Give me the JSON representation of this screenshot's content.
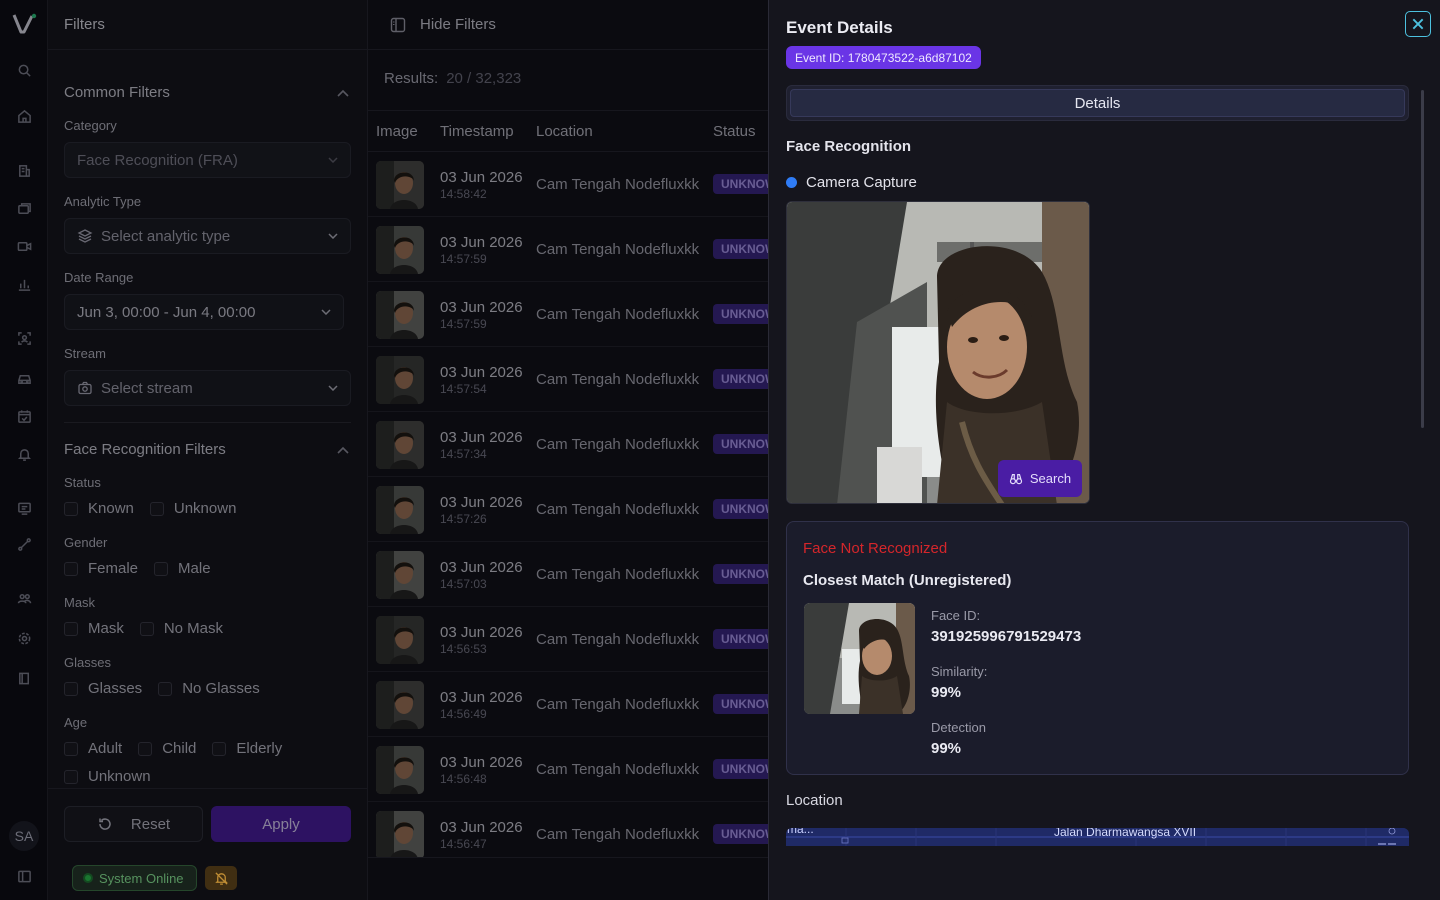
{
  "rail": {
    "avatar_initials": "SA",
    "icons": [
      "search-icon",
      "home-icon",
      "building-icon",
      "layers-icon",
      "camera-icon",
      "chart-icon",
      "face-scan-icon",
      "car-icon",
      "calendar-check-icon",
      "bell-icon",
      "monitor-chat-icon",
      "route-icon",
      "users-icon",
      "settings-icon",
      "book-icon",
      "sidebar-toggle-icon"
    ]
  },
  "filters": {
    "title": "Filters",
    "common": {
      "title": "Common Filters",
      "category_label": "Category",
      "category_value": "Face Recognition (FRA)",
      "analytic_label": "Analytic Type",
      "analytic_placeholder": "Select analytic type",
      "date_label": "Date Range",
      "date_value": "Jun 3, 00:00 - Jun 4, 00:00",
      "stream_label": "Stream",
      "stream_placeholder": "Select stream"
    },
    "face": {
      "title": "Face Recognition Filters",
      "status_label": "Status",
      "status_options": [
        "Known",
        "Unknown"
      ],
      "gender_label": "Gender",
      "gender_options": [
        "Female",
        "Male"
      ],
      "mask_label": "Mask",
      "mask_options": [
        "Mask",
        "No Mask"
      ],
      "glasses_label": "Glasses",
      "glasses_options": [
        "Glasses",
        "No Glasses"
      ],
      "age_label": "Age",
      "age_options": [
        "Adult",
        "Child",
        "Elderly",
        "Unknown"
      ]
    },
    "reset_label": "Reset",
    "apply_label": "Apply"
  },
  "status_bar": {
    "online_label": "System Online"
  },
  "results": {
    "hide_filters_label": "Hide Filters",
    "results_label": "Results:",
    "results_count": "20 / 32,323",
    "columns": [
      "Image",
      "Timestamp",
      "Location",
      "Status"
    ],
    "rows": [
      {
        "date": "03 Jun 2026",
        "time": "14:58:42",
        "location": "Cam Tengah Nodefluxkk",
        "status": "UNKNOWN"
      },
      {
        "date": "03 Jun 2026",
        "time": "14:57:59",
        "location": "Cam Tengah Nodefluxkk",
        "status": "UNKNOWN"
      },
      {
        "date": "03 Jun 2026",
        "time": "14:57:59",
        "location": "Cam Tengah Nodefluxkk",
        "status": "UNKNOWN"
      },
      {
        "date": "03 Jun 2026",
        "time": "14:57:54",
        "location": "Cam Tengah Nodefluxkk",
        "status": "UNKNOWN"
      },
      {
        "date": "03 Jun 2026",
        "time": "14:57:34",
        "location": "Cam Tengah Nodefluxkk",
        "status": "UNKNOWN"
      },
      {
        "date": "03 Jun 2026",
        "time": "14:57:26",
        "location": "Cam Tengah Nodefluxkk",
        "status": "UNKNOWN"
      },
      {
        "date": "03 Jun 2026",
        "time": "14:57:03",
        "location": "Cam Tengah Nodefluxkk",
        "status": "UNKNOWN"
      },
      {
        "date": "03 Jun 2026",
        "time": "14:56:53",
        "location": "Cam Tengah Nodefluxkk",
        "status": "UNKNOWN"
      },
      {
        "date": "03 Jun 2026",
        "time": "14:56:49",
        "location": "Cam Tengah Nodefluxkk",
        "status": "UNKNOWN"
      },
      {
        "date": "03 Jun 2026",
        "time": "14:56:48",
        "location": "Cam Tengah Nodefluxkk",
        "status": "UNKNOWN"
      },
      {
        "date": "03 Jun 2026",
        "time": "14:56:47",
        "location": "Cam Tengah Nodefluxkk",
        "status": "UNKNOWN"
      }
    ]
  },
  "event": {
    "title": "Event Details",
    "event_id": "Event ID: 1780473522-a6d87102",
    "tab_details": "Details",
    "section_face": "Face Recognition",
    "camera_capture": "Camera Capture",
    "search_label": "Search",
    "not_recognized": "Face Not Recognized",
    "closest_match": "Closest Match (Unregistered)",
    "face_id_label": "Face ID:",
    "face_id_value": "391925996791529473",
    "similarity_label": "Similarity:",
    "similarity_value": "99%",
    "detection_label": "Detection",
    "detection_value": "99%",
    "location_label": "Location",
    "map_street": "Jalan Dharmawangsa XVII",
    "map_street2": "ma..."
  },
  "colors": {
    "accent_purple": "#4a1e9e",
    "event_badge": "#6a35e6",
    "not_recognized_red": "#d4262b",
    "online_green": "#1f9a3a",
    "close_cyan": "#4dc1df"
  }
}
